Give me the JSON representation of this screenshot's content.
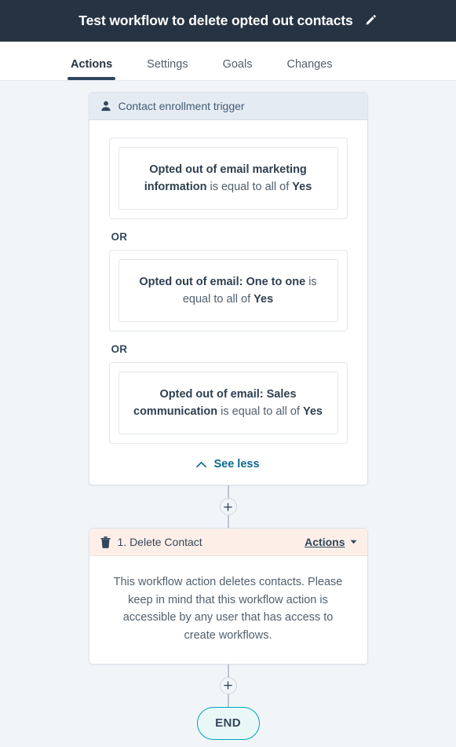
{
  "topbar": {
    "title": "Test workflow to delete opted out contacts",
    "edit_icon": "pencil-icon"
  },
  "tabs": [
    {
      "label": "Actions",
      "active": true
    },
    {
      "label": "Settings",
      "active": false
    },
    {
      "label": "Goals",
      "active": false
    },
    {
      "label": "Changes",
      "active": false
    }
  ],
  "trigger": {
    "icon": "contact-person-icon",
    "header_label": "Contact enrollment trigger",
    "conditions": [
      {
        "property": "Opted out of email marketing information",
        "operator": " is equal to all of ",
        "value": "Yes"
      },
      {
        "property": "Opted out of email: One to one",
        "operator": " is equal to all of ",
        "value": "Yes"
      },
      {
        "property": "Opted out of email: Sales communication",
        "operator": " is equal to all of ",
        "value": "Yes"
      }
    ],
    "or_label": "OR",
    "see_less_label": "See less",
    "see_less_icon": "chevron-up-icon"
  },
  "action": {
    "icon": "trash-icon",
    "title": "1. Delete Contact",
    "menu_label": "Actions",
    "menu_icon": "caret-down-icon",
    "description": "This workflow action deletes contacts. Please keep in mind that this workflow action is accessible by any user that has access to create workflows."
  },
  "connectors": {
    "add_icon": "plus-icon"
  },
  "end": {
    "label": "END"
  },
  "colors": {
    "topbar_bg": "#253342",
    "canvas_bg": "#f2f5f8",
    "trigger_header_bg": "#e5ebf2",
    "action_header_bg": "#fdefe8",
    "tab_active_underline": "#2e475d",
    "link_teal": "#0b6c8c",
    "end_border": "#00a4bd",
    "end_bg": "#eaf7f7"
  }
}
